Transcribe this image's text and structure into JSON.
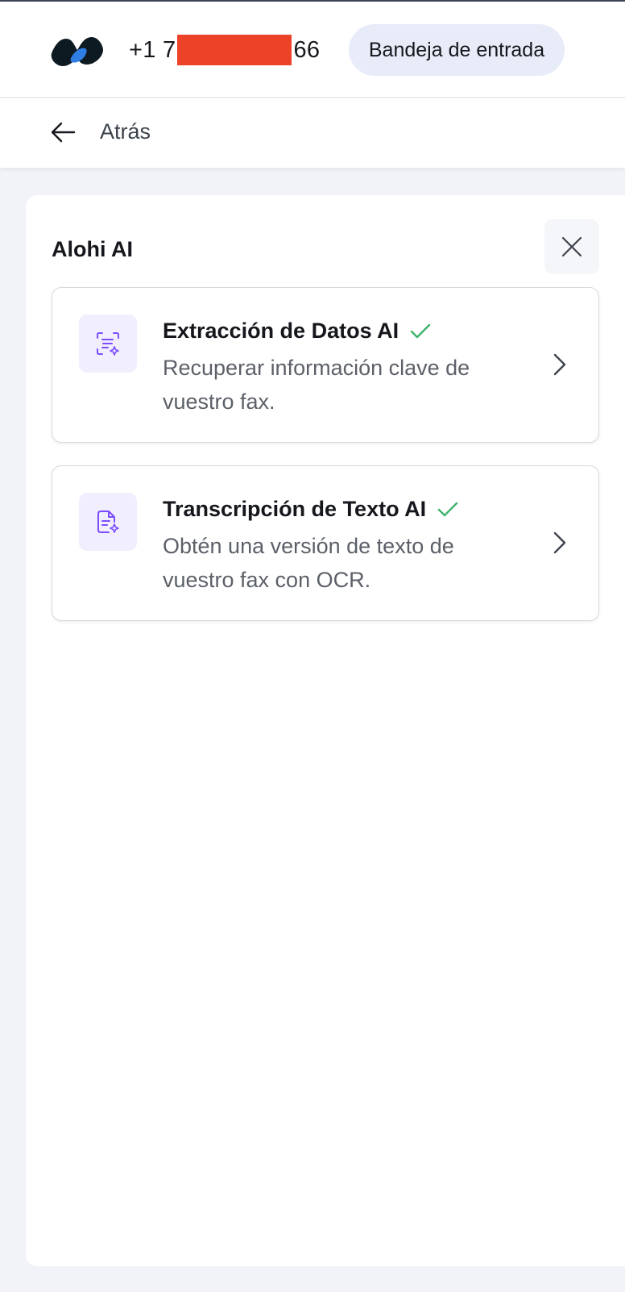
{
  "header": {
    "phone_prefix": "+1 7",
    "phone_suffix": "66",
    "inbox_label": "Bandeja de entrada"
  },
  "subbar": {
    "back_label": "Atrás"
  },
  "panel": {
    "title": "Alohi AI",
    "cards": [
      {
        "title": "Extracción de Datos AI",
        "description": "Recuperar información clave de vuestro fax.",
        "icon": "data-extraction-icon",
        "status_icon": "check-icon"
      },
      {
        "title": "Transcripción de Texto AI",
        "description": "Obtén una versión de texto de vuestro fax con OCR.",
        "icon": "text-transcription-icon",
        "status_icon": "check-icon"
      }
    ]
  },
  "colors": {
    "accent_purple": "#7c4dff",
    "check_green": "#3db36b",
    "redaction": "#ec4227",
    "inbox_pill": "#e7ecf8"
  }
}
